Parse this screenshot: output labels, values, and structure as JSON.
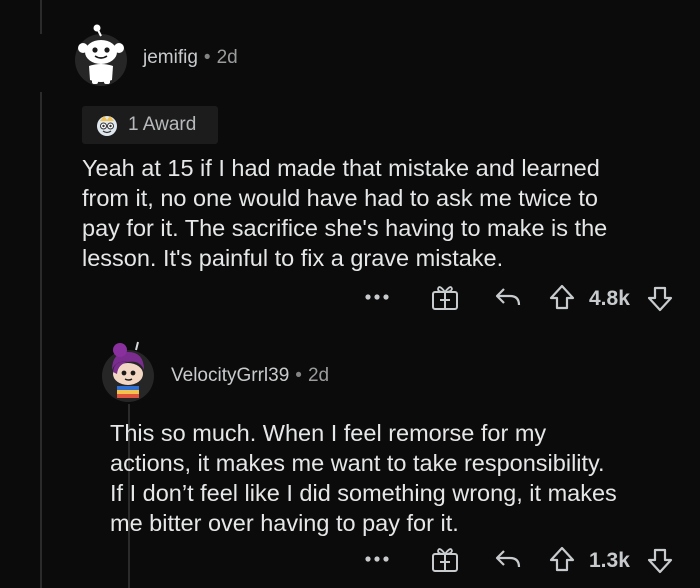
{
  "comment": {
    "username": "jemifig",
    "separator": "•",
    "age": "2d",
    "award_label": "1 Award",
    "body_lines": [
      "Yeah at 15 if I had made that mistake and learned",
      "from it, no one would have had to ask me twice to",
      "pay for it. The sacrifice she's having to make is the",
      "lesson. It's painful to fix a grave mistake."
    ],
    "score": "4.8k"
  },
  "reply": {
    "username": "VelocityGrrl39",
    "separator": "•",
    "age": "2d",
    "body_lines": [
      "This so much. When I feel remorse for my",
      "actions, it makes me want to take responsibility.",
      "If I don’t feel like I did something wrong, it makes",
      "me bitter over having to pay for it."
    ],
    "score": "1.3k"
  },
  "icons": [
    "more-icon",
    "gift-award-icon",
    "reply-icon",
    "upvote-icon",
    "downvote-icon"
  ],
  "colors": {
    "background": "#0b0b0b",
    "text": "#e6e7e8",
    "muted": "#818384"
  }
}
